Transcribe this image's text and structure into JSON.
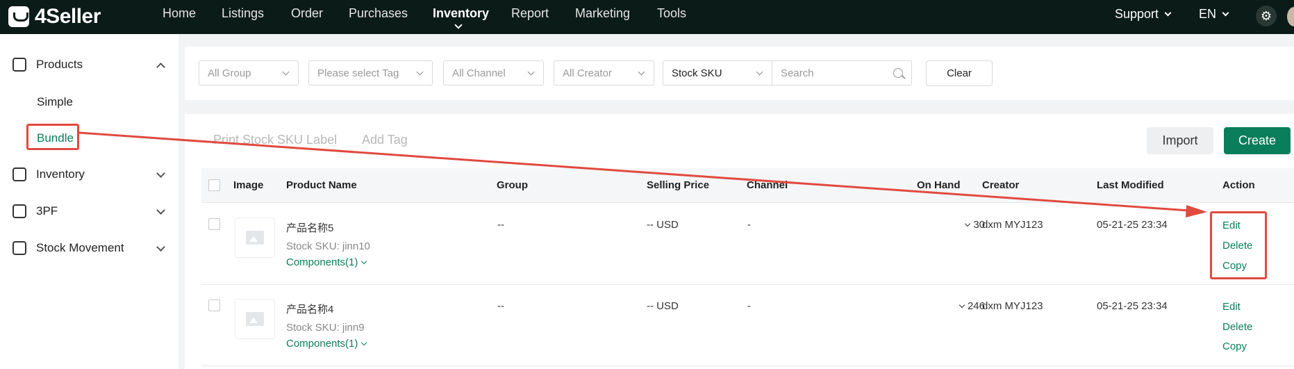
{
  "brand": {
    "name": "4Seller"
  },
  "nav": {
    "items": [
      "Home",
      "Listings",
      "Order",
      "Purchases",
      "Inventory",
      "Report",
      "Marketing",
      "Tools"
    ],
    "active": "Inventory",
    "support": "Support",
    "language": "EN"
  },
  "sidebar": {
    "products": "Products",
    "simple": "Simple",
    "bundle": "Bundle",
    "inventory": "Inventory",
    "threepf": "3PF",
    "stock_movement": "Stock Movement"
  },
  "filters": {
    "group": "All Group",
    "tag": "Please select Tag",
    "channel": "All Channel",
    "creator": "All Creator",
    "search_field": "Stock SKU",
    "search_placeholder": "Search",
    "clear": "Clear"
  },
  "toolbar": {
    "print_label": "Print Stock SKU Label",
    "add_tag": "Add Tag",
    "import": "Import",
    "create": "Create"
  },
  "table": {
    "headers": {
      "image": "Image",
      "product_name": "Product Name",
      "group": "Group",
      "selling_price": "Selling Price",
      "channel": "Channel",
      "on_hand": "On Hand",
      "creator": "Creator",
      "last_modified": "Last Modified",
      "action": "Action"
    },
    "rows": [
      {
        "name": "产品名称5",
        "sku": "Stock SKU: jinn10",
        "components": "Components(1)",
        "group": "--",
        "price": "-- USD",
        "channel": "-",
        "on_hand": "30",
        "creator": "dxm MYJ123",
        "modified": "05-21-25 23:34",
        "edit": "Edit",
        "delete": "Delete",
        "copy": "Copy"
      },
      {
        "name": "产品名称4",
        "sku": "Stock SKU: jinn9",
        "components": "Components(1)",
        "group": "--",
        "price": "-- USD",
        "channel": "-",
        "on_hand": "246",
        "creator": "dxm MYJ123",
        "modified": "05-21-25 23:34",
        "edit": "Edit",
        "delete": "Delete",
        "copy": "Copy"
      }
    ]
  },
  "colors": {
    "topbar": "#0b1b17",
    "brand_green": "#0a7d5a",
    "annotation_red": "#e04a3f"
  }
}
